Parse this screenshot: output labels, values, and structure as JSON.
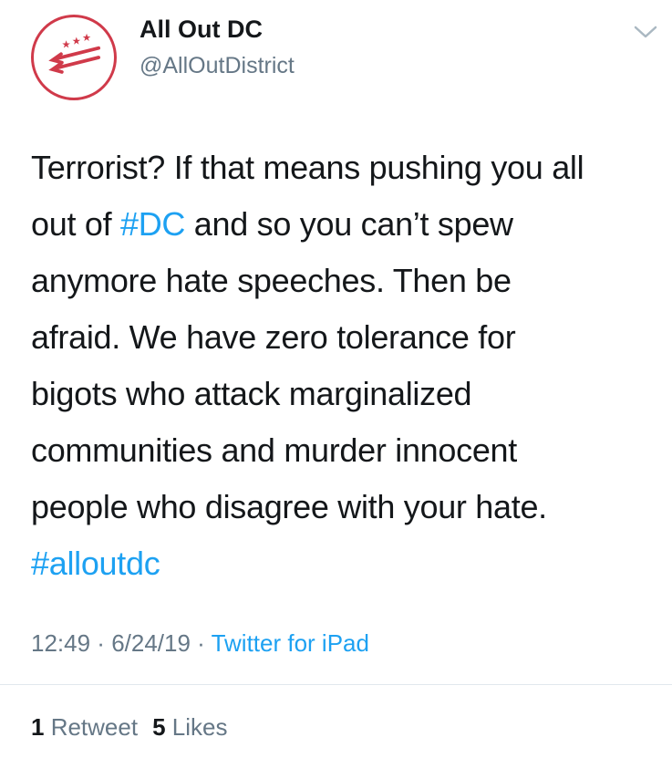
{
  "user": {
    "display_name": "All Out DC",
    "handle": "@AllOutDistrict",
    "avatar_icon": "dc-flag-logo-icon",
    "brand_color": "#d03a4a"
  },
  "menu": {
    "icon": "chevron-down-icon"
  },
  "tweet": {
    "lines": [
      [
        {
          "t": "Terrorist? If that means pushing you all"
        }
      ],
      [
        {
          "t": "out of "
        },
        {
          "t": "#DC",
          "tag": true
        },
        {
          "t": " and so you can’t spew"
        }
      ],
      [
        {
          "t": "anymore hate speeches. Then be"
        }
      ],
      [
        {
          "t": "afraid.  We have zero tolerance for"
        }
      ],
      [
        {
          "t": "bigots who attack marginalized"
        }
      ],
      [
        {
          "t": "communities and murder innocent"
        }
      ],
      [
        {
          "t": "people who disagree with your hate."
        }
      ],
      [
        {
          "t": "#alloutdc",
          "tag": true
        }
      ]
    ]
  },
  "meta": {
    "time": "12:49",
    "separator": " · ",
    "date": "6/24/19",
    "source": "Twitter for iPad"
  },
  "stats": {
    "retweet_count": "1",
    "retweet_label": " Retweet",
    "like_count": "5",
    "like_label": " Likes"
  },
  "colors": {
    "link": "#1da1f2",
    "secondary_text": "#657786",
    "primary_text": "#14171a"
  }
}
